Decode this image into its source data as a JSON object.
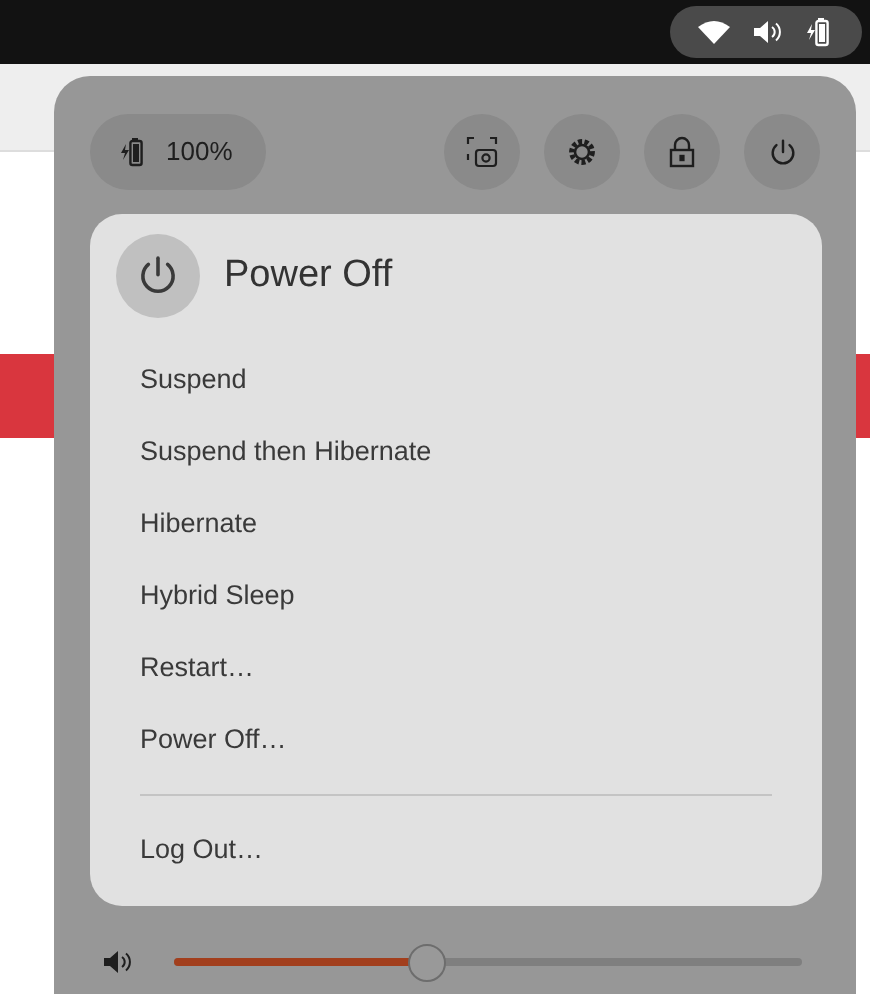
{
  "battery": {
    "label": "100%"
  },
  "header": {
    "title": "Power Off"
  },
  "items": [
    {
      "label": "Suspend",
      "kind": "item"
    },
    {
      "label": "Suspend then Hibernate",
      "kind": "item"
    },
    {
      "label": "Hibernate",
      "kind": "item"
    },
    {
      "label": "Hybrid Sleep",
      "kind": "item"
    },
    {
      "label": "Restart…",
      "kind": "item"
    },
    {
      "label": "Power Off…",
      "kind": "item"
    },
    {
      "kind": "separator"
    },
    {
      "label": "Log Out…",
      "kind": "item"
    }
  ],
  "volume": {
    "level": 0.4
  }
}
